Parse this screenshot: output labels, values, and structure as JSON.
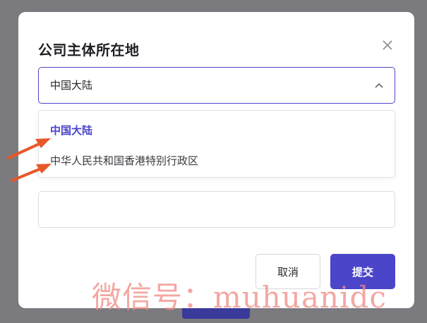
{
  "dialog": {
    "title": "公司主体所在地",
    "close_icon": "close-icon"
  },
  "select": {
    "value": "中国大陆",
    "chevron_icon": "chevron-up-icon"
  },
  "dropdown": {
    "options": [
      {
        "label": "中国大陆",
        "selected": true
      },
      {
        "label": "中华人民共和国香港特别行政区",
        "selected": false
      }
    ]
  },
  "buttons": {
    "cancel_label": "取消",
    "submit_label": "提交"
  },
  "colors": {
    "accent": "#4b45c9",
    "arrow": "#e8572a",
    "overlay": "#7a7a7f"
  },
  "watermark": {
    "text": "微信号：muhuanidc"
  }
}
